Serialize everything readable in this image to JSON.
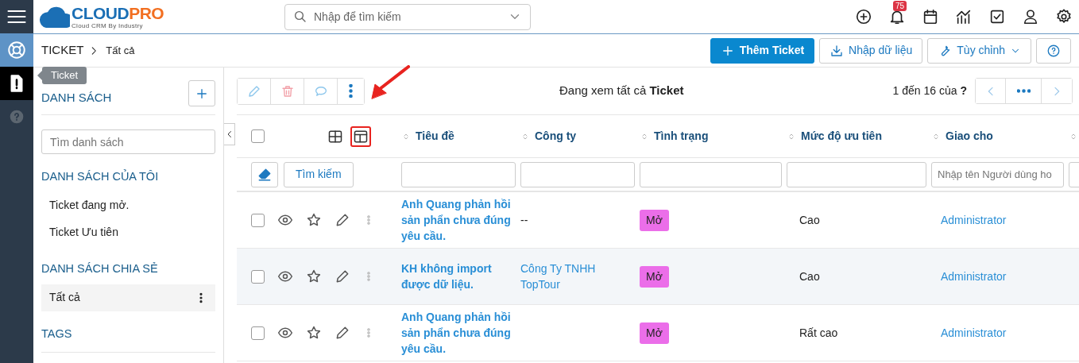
{
  "header": {
    "logo": {
      "brand_main": "CLOUD",
      "brand_accent": "PRO",
      "tagline": "Cloud CRM By Industry"
    },
    "search": {
      "placeholder": "Nhập để tìm kiếm"
    },
    "notification_count": "75"
  },
  "rail": {
    "items": [
      {
        "kind": "support",
        "selected": false
      },
      {
        "kind": "ticket",
        "selected": true
      },
      {
        "kind": "help",
        "selected": false
      }
    ],
    "tooltip": "Ticket"
  },
  "breadcrumb": {
    "module": "TICKET",
    "view": "Tất cả"
  },
  "actions": [
    {
      "kind": "add",
      "label": "Thêm Ticket"
    },
    {
      "kind": "import",
      "label": "Nhập dữ liệu"
    },
    {
      "kind": "customize",
      "label": "Tùy chỉnh"
    },
    {
      "kind": "help"
    }
  ],
  "list_panel": {
    "title": "DANH SÁCH",
    "search_placeholder": "Tìm danh sách",
    "sections": [
      {
        "title": "DANH SÁCH CỦA TÔI",
        "items": [
          {
            "label": "Ticket đang mở.",
            "selected": false
          },
          {
            "label": "Ticket Ưu tiên",
            "selected": false
          }
        ]
      },
      {
        "title": "DANH SÁCH CHIA SẺ",
        "items": [
          {
            "label": "Tất cả",
            "selected": true
          }
        ]
      },
      {
        "title": "TAGS"
      }
    ]
  },
  "toolbar": {
    "viewing": "Đang xem tất cả **Ticket**",
    "range": "1 đến 16 của **?**"
  },
  "table": {
    "select_all": {
      "checked": false
    },
    "view_modes": [
      {
        "kind": "grid",
        "selected": false
      },
      {
        "kind": "split",
        "selected": true
      }
    ],
    "annotation_arrow": true,
    "columns": [
      "Tiêu đề",
      "Công ty",
      "Tình trạng",
      "Mức độ ưu tiên",
      "Giao cho"
    ],
    "search_button": "Tìm kiếm",
    "assignee_filter_placeholder": "Nhập tên Người dùng ho",
    "rows": [
      {
        "title": "Anh Quang phản hồi sản phẩn chưa đúng yêu cầu.",
        "company": {
          "text": "--",
          "linked": false
        },
        "status": "Mở",
        "priority": "Cao",
        "assignee": "Administrator",
        "highlighted": false,
        "checked": false
      },
      {
        "title": "KH không import được dữ liệu.",
        "company": {
          "text": "Công Ty TNHH TopTour",
          "linked": true
        },
        "status": "Mở",
        "priority": "Cao",
        "assignee": "Administrator",
        "highlighted": true,
        "checked": false
      },
      {
        "title": "Anh Quang phản hồi sản phẩn chưa đúng yêu cầu.",
        "status": "Mở",
        "priority": "Rất cao",
        "assignee": "Administrator",
        "highlighted": false,
        "checked": false
      }
    ]
  }
}
